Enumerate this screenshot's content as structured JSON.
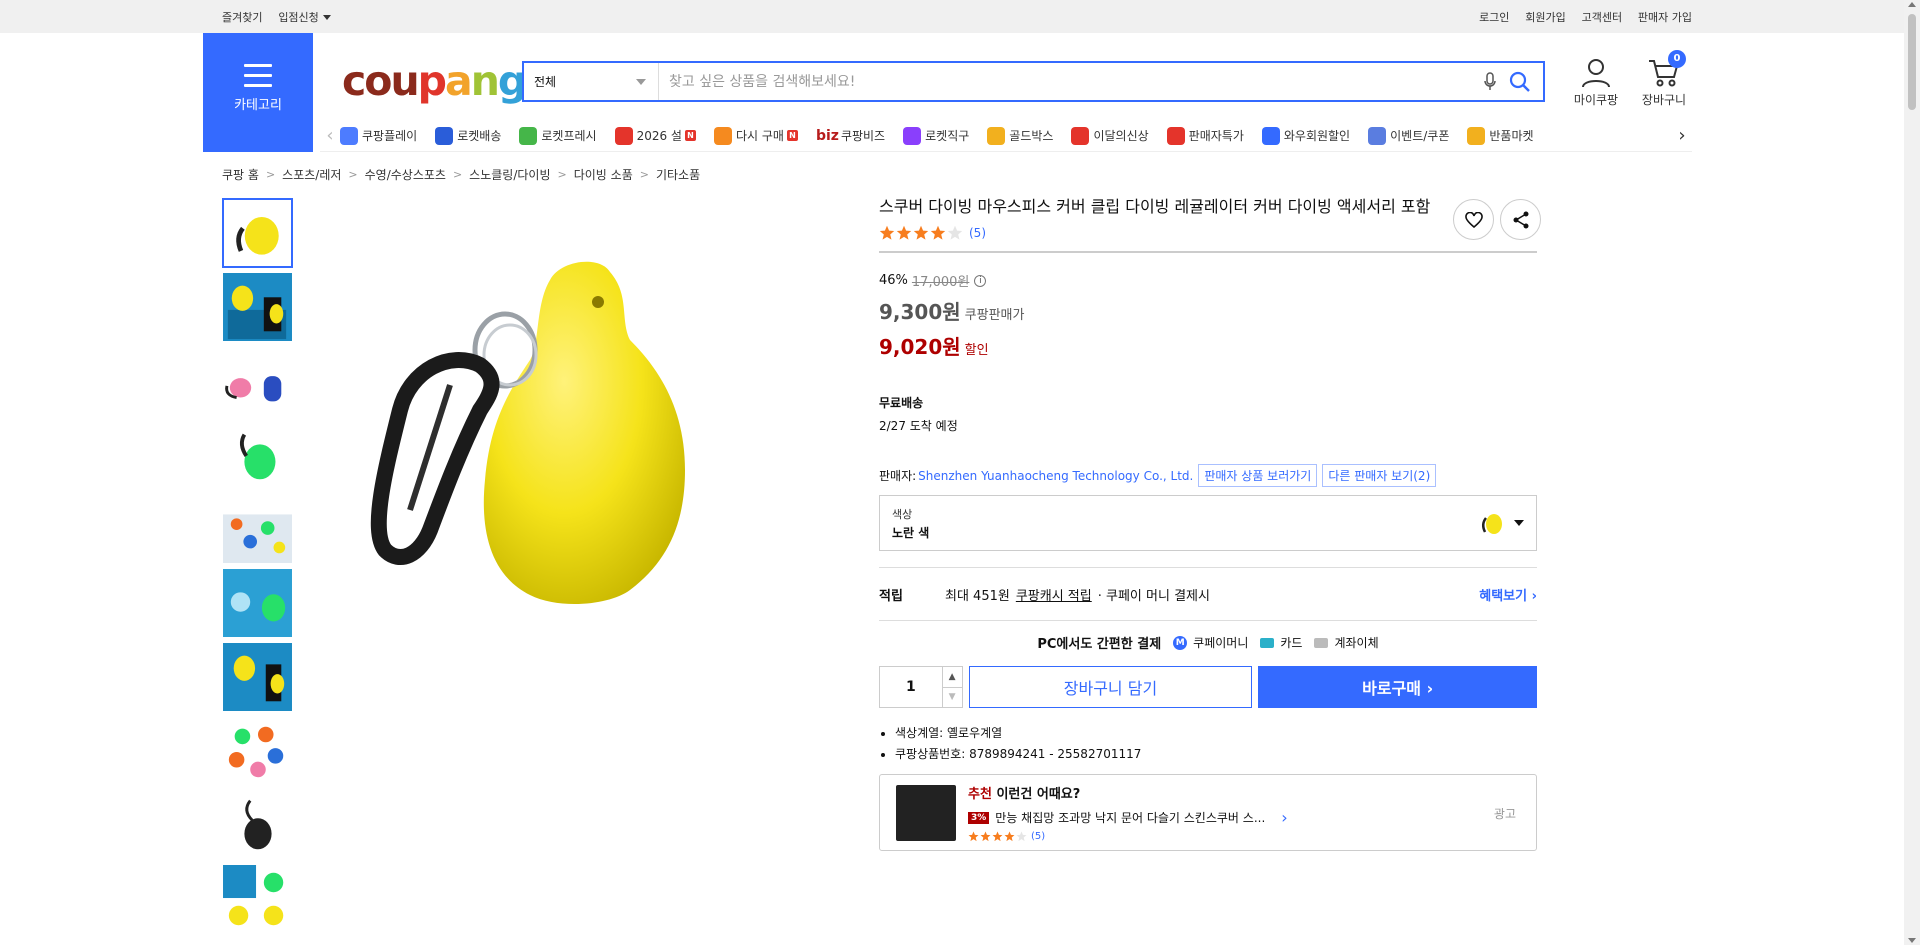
{
  "topbar": {
    "left": [
      "즐겨찾기",
      "입점신청"
    ],
    "right": [
      "로그인",
      "회원가입",
      "고객센터",
      "판매자 가입"
    ]
  },
  "header": {
    "category_label": "카테고리",
    "logo": [
      "cou",
      "p",
      "a",
      "n",
      "g"
    ],
    "search_category": "전체",
    "search_placeholder": "찾고 싶은 상품을 검색해보세요!",
    "mycoupang_label": "마이쿠팡",
    "cart_label": "장바구니",
    "cart_count": "0"
  },
  "nav": [
    {
      "label": "쿠팡플레이",
      "color": "#4d7cff"
    },
    {
      "label": "로켓배송",
      "color": "#2a5dd9"
    },
    {
      "label": "로켓프레시",
      "color": "#45b649"
    },
    {
      "label": "2026 설",
      "color": "#e4342b",
      "new": "N"
    },
    {
      "label": "다시 구매",
      "color": "#f58a1f",
      "new": "N"
    },
    {
      "label": "쿠팡비즈",
      "biz": "biz"
    },
    {
      "label": "로켓직구",
      "color": "#8a3ffc"
    },
    {
      "label": "골드박스",
      "color": "#f2b01e"
    },
    {
      "label": "이달의신상",
      "color": "#e4342b"
    },
    {
      "label": "판매자특가",
      "color": "#e4342b"
    },
    {
      "label": "와우회원할인",
      "color": "#346aff"
    },
    {
      "label": "이벤트/쿠폰",
      "color": "#5a7de0"
    },
    {
      "label": "반품마켓",
      "color": "#f2b01e"
    }
  ],
  "breadcrumb": [
    "쿠팡 홈",
    "스포츠/레저",
    "수영/수상스포츠",
    "스노클링/다이빙",
    "다이빙 소품",
    "기타소품"
  ],
  "product": {
    "title": "스쿠버 다이빙 마우스피스 커버 클립 다이빙 레귤레이터 커버 다이빙 액세서리 포함",
    "rating": 4,
    "review_count": "(5)",
    "discount_rate": "46%",
    "original_price": "17,000원",
    "price": "9,300원",
    "price_label": "쿠팡판매가",
    "sale_price": "9,020원",
    "sale_label": "할인",
    "shipping_title": "무료배송",
    "shipping_date": "2/27 도착 예정",
    "seller_prefix": "판매자:",
    "seller_name": "Shenzhen Yuanhaocheng Technology Co., Ltd.",
    "seller_products_btn": "판매자 상품 보러가기",
    "other_sellers_btn": "다른 판매자 보기(2)",
    "option_label": "색상",
    "option_value": "노란 색",
    "reward_key": "적립",
    "reward_text": "최대 451원",
    "reward_link": "쿠팡캐시 적립",
    "reward_suffix": "· 쿠페이 머니 결제시",
    "reward_more": "혜택보기 ›",
    "pay_title": "PC에서도 간편한 결제",
    "pay_methods": [
      "쿠페이머니",
      "카드",
      "계좌이체"
    ],
    "quantity": "1",
    "cart_btn": "장바구니 담기",
    "buy_btn": "바로구매 ›",
    "attributes": [
      "색상계열: 옐로우계열",
      "쿠팡상품번호: 8789894241 - 25582701117"
    ]
  },
  "thumbnails": [
    "yellow",
    "yellow-diver",
    "pink-blue",
    "green",
    "multi-text",
    "diver",
    "yellow-diver-2",
    "multi-color",
    "black",
    "collage"
  ],
  "recommend": {
    "prefix": "추천",
    "title": "이런건 어때요?",
    "discount": "3%",
    "product": "만능 채집망 조과망 낙지 문어 다슬기 스킨스쿠버 스...",
    "rating": 4,
    "count": "(5)",
    "ad_label": "광고"
  },
  "colors": {
    "accent": "#346aff",
    "sale": "#ae0000",
    "star": "#f77d1e",
    "product_yellow": "#f5e31a"
  }
}
